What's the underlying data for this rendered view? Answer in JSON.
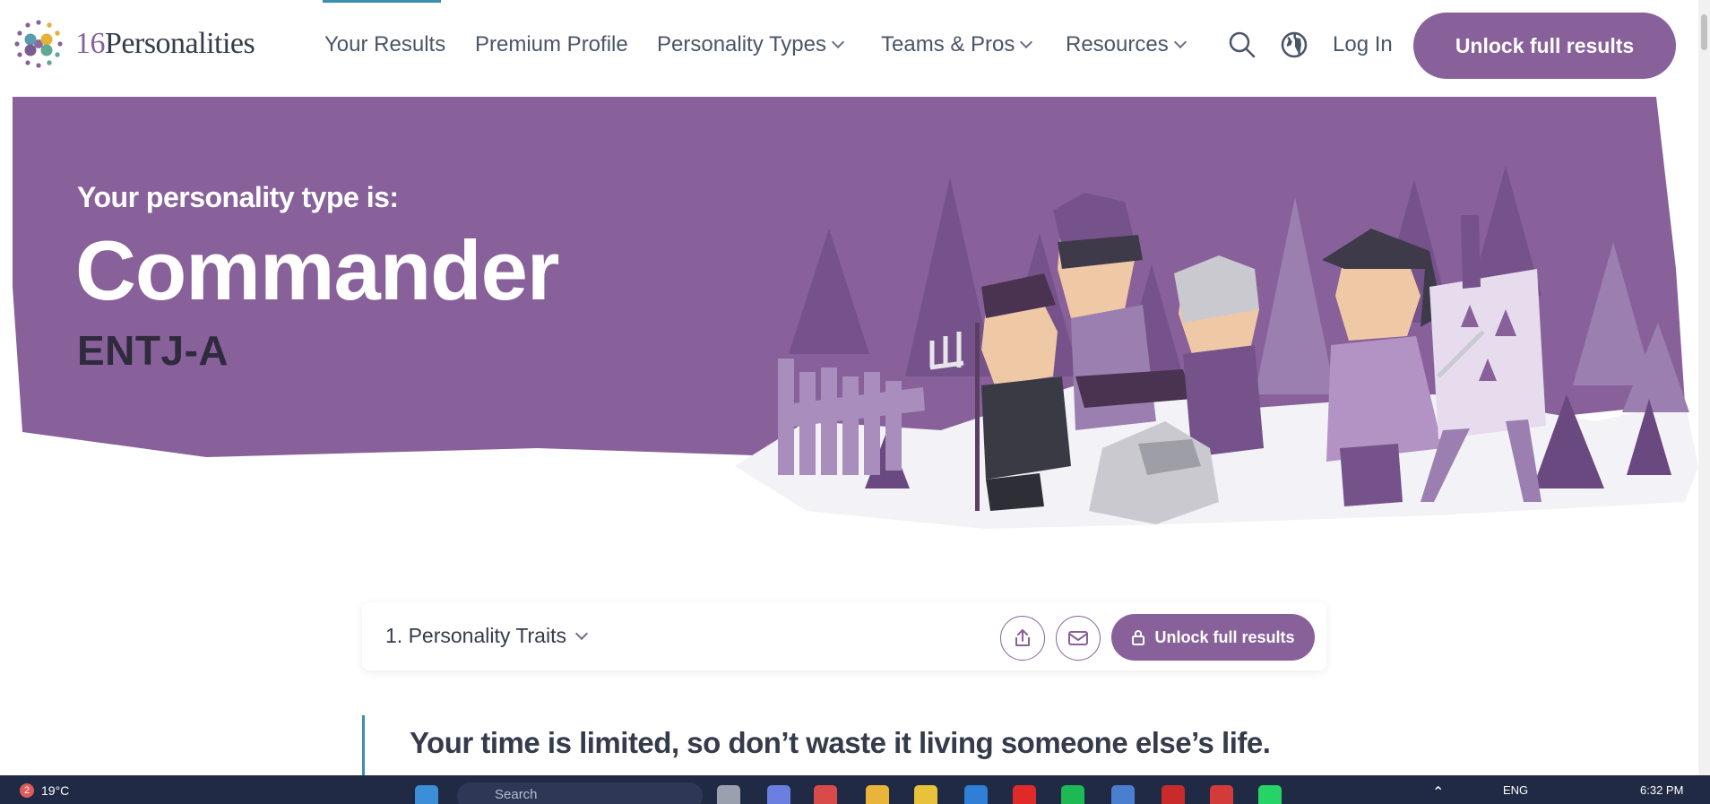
{
  "brand": {
    "logo_number": "16",
    "logo_word": "Personalities"
  },
  "nav": {
    "items": [
      {
        "label": "Your Results"
      },
      {
        "label": "Premium Profile"
      },
      {
        "label": "Personality Types"
      },
      {
        "label": "Teams & Pros"
      },
      {
        "label": "Resources"
      }
    ],
    "login_label": "Log In",
    "unlock_label": "Unlock full results"
  },
  "hero": {
    "label": "Your personality type is:",
    "type_name": "Commander",
    "type_code": "ENTJ-A"
  },
  "section": {
    "title": "1. Personality Traits",
    "unlock_label": "Unlock full results"
  },
  "quote": "Your time is limited, so don’t waste it living someone else’s life.",
  "taskbar": {
    "notification_count": "2",
    "temperature": "19°C",
    "search_placeholder": "Search",
    "language": "ENG",
    "time": "6:32 PM"
  },
  "colors": {
    "brand_purple": "#88619a",
    "hero_purple": "#88619a",
    "accent_blue": "#3a8fb0",
    "taskbar": "#202a44"
  }
}
